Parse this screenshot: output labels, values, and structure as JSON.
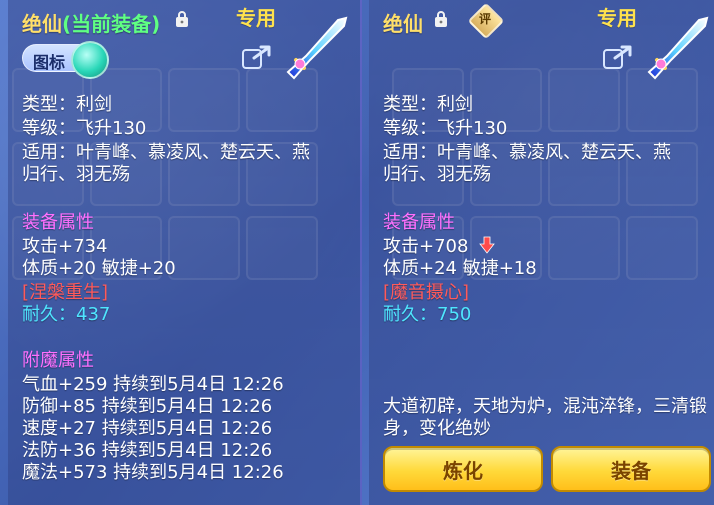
{
  "left": {
    "title_main": "绝仙",
    "title_sub": "(当前装备)",
    "exclusive": "专用",
    "icon_label": "图标",
    "type_line": "类型：利剑",
    "level_line": "等级：飞升130",
    "apply_line1": "适用：叶青峰、慕凌风、楚云天、燕",
    "apply_line2": "归行、羽无殇",
    "attr_title": "装备属性",
    "attack": "攻击+734",
    "stats": "体质+20 敏捷+20",
    "special": "[涅槃重生]",
    "durability_label": "耐久：",
    "durability_value": "437",
    "enchant_title": "附魔属性",
    "enchant": [
      "气血+259 持续到5月4日 12:26",
      "防御+85 持续到5月4日 12:26",
      "速度+27 持续到5月4日 12:26",
      "法防+36 持续到5月4日 12:26",
      "魔法+573 持续到5月4日 12:26"
    ]
  },
  "right": {
    "title_main": "绝仙",
    "exclusive": "专用",
    "badge": "评",
    "type_line": "类型：利剑",
    "level_line": "等级：飞升130",
    "apply_line1": "适用：叶青峰、慕凌风、楚云天、燕",
    "apply_line2": "归行、羽无殇",
    "attr_title": "装备属性",
    "attack": "攻击+708",
    "stats": "体质+24 敏捷+18",
    "special": "[魔音摄心]",
    "durability_label": "耐久：",
    "durability_value": "750",
    "desc": "大道初辟，天地为炉，混沌淬锋，三清锻身，变化绝妙",
    "btn_refine": "炼化",
    "btn_equip": "装备"
  },
  "colors": {
    "title": "#ffdf6a",
    "section": "#ff70ff",
    "durability": "#4fe6ff",
    "special": "#ff5a5a"
  }
}
